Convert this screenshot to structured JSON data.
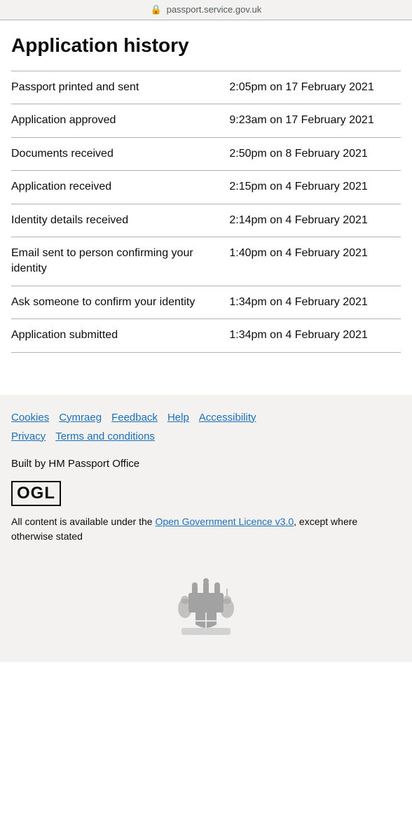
{
  "topbar": {
    "url": "passport.service.gov.uk",
    "lock_symbol": "🔒"
  },
  "page": {
    "title": "Application history"
  },
  "history": {
    "rows": [
      {
        "event": "Passport printed and sent",
        "date": "2:05pm on 17 February 2021"
      },
      {
        "event": "Application approved",
        "date": "9:23am on 17 February 2021"
      },
      {
        "event": "Documents received",
        "date": "2:50pm on 8 February 2021"
      },
      {
        "event": "Application received",
        "date": "2:15pm on 4 February 2021"
      },
      {
        "event": "Identity details received",
        "date": "2:14pm on 4 February 2021"
      },
      {
        "event": "Email sent to person confirming your identity",
        "date": "1:40pm on 4 February 2021"
      },
      {
        "event": "Ask someone to confirm your identity",
        "date": "1:34pm on 4 February 2021"
      },
      {
        "event": "Application submitted",
        "date": "1:34pm on 4 February 2021"
      }
    ]
  },
  "footer": {
    "links": [
      {
        "label": "Cookies",
        "href": "#"
      },
      {
        "label": "Cymraeg",
        "href": "#"
      },
      {
        "label": "Feedback",
        "href": "#"
      },
      {
        "label": "Help",
        "href": "#"
      },
      {
        "label": "Accessibility",
        "href": "#"
      },
      {
        "label": "Privacy",
        "href": "#"
      },
      {
        "label": "Terms and conditions",
        "href": "#"
      }
    ],
    "built_by": "Built by HM Passport Office",
    "ogl_label": "OGL",
    "ogl_text_before": "All content is available under the ",
    "ogl_link_label": "Open Government Licence v3.0",
    "ogl_text_after": ", except where otherwise stated"
  }
}
